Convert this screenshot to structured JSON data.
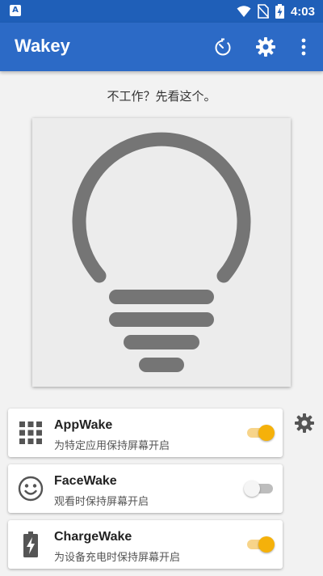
{
  "statusbar": {
    "time": "4:03",
    "left_icon": "A",
    "icons": [
      "wifi-icon",
      "no-sim-icon",
      "battery-charging-icon"
    ]
  },
  "appbar": {
    "title": "Wakey",
    "actions": [
      "timer-icon",
      "settings-icon",
      "more-vert-icon"
    ]
  },
  "help_text": "不工作？先看这个。",
  "cards": [
    {
      "name": "AppWake",
      "desc": "为特定应用保持屏幕开启",
      "icon": "apps-grid-icon",
      "enabled": true
    },
    {
      "name": "FaceWake",
      "desc": "观看时保持屏幕开启",
      "icon": "face-icon",
      "enabled": false
    },
    {
      "name": "ChargeWake",
      "desc": "为设备充电时保持屏幕开启",
      "icon": "battery-charging-icon",
      "enabled": true
    }
  ],
  "colors": {
    "primary": "#2c6ac6",
    "primary_dark": "#1f5fb8",
    "accent": "#f5b10a",
    "bulb": "#757575"
  }
}
